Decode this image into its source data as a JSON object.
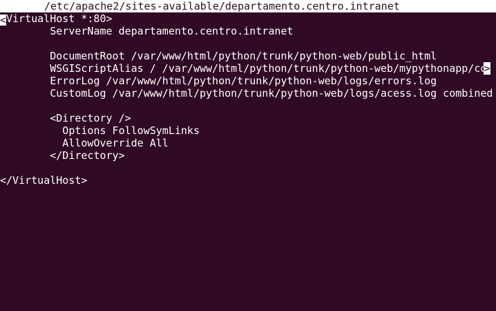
{
  "title_bar": {
    "file_path": "/etc/apache2/sites-available/departamento.centro.intranet"
  },
  "editor": {
    "lines": {
      "l1": "VirtualHost *:80>",
      "l2": "        ServerName departamento.centro.intranet",
      "l3": "",
      "l4": "        DocumentRoot /var/www/html/python/trunk/python-web/public_html",
      "l5": "        WSGIScriptAlias / /var/www/html/python/trunk/python-web/mypythonapp/co",
      "l6": "        ErrorLog /var/www/html/python/trunk/python-web/logs/errors.log",
      "l7": "        CustomLog /var/www/html/python/trunk/python-web/logs/acess.log combined",
      "l8": "",
      "l9": "        <Directory />",
      "l10": "          Options FollowSymLinks",
      "l11": "          AllowOverride All",
      "l12": "        </Directory>",
      "l13": "",
      "l14": "</VirtualHost>"
    },
    "cursor_char": "<",
    "overflow_marker": ">"
  },
  "colors": {
    "background": "#300a24",
    "foreground": "#ffffff"
  }
}
